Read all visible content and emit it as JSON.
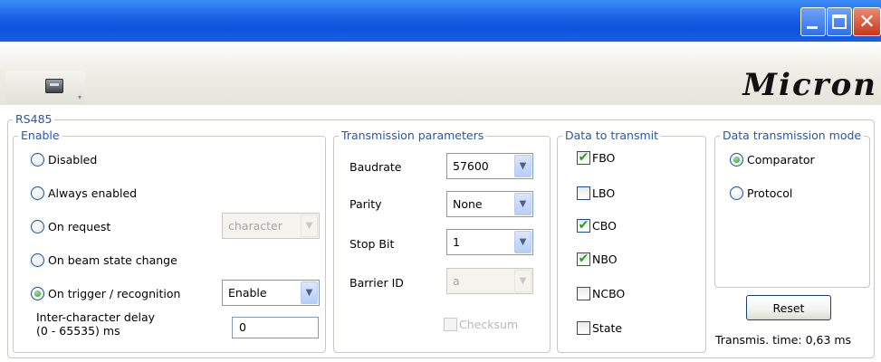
{
  "window": {
    "minimize_icon": "minimize-icon",
    "maximize_icon": "maximize-icon",
    "close_icon": "close-icon",
    "close_glyph": "✕"
  },
  "toolbar": {
    "device_icon": "device-icon",
    "dropdown_arrow": "▾",
    "logo_text": "Micron"
  },
  "rs485": {
    "title": "RS485",
    "enable": {
      "title": "Enable",
      "options": [
        {
          "label": "Disabled",
          "checked": false
        },
        {
          "label": "Always enabled",
          "checked": false
        },
        {
          "label": "On request",
          "checked": false
        },
        {
          "label": "On beam state change",
          "checked": false
        },
        {
          "label": "On trigger / recognition",
          "checked": true
        }
      ],
      "on_request_combo": {
        "value": "character",
        "disabled": true
      },
      "trigger_combo": {
        "value": "Enable",
        "disabled": false
      },
      "delay_label_line1": "Inter-character delay",
      "delay_label_line2": "(0 - 65535) ms",
      "delay_value": "0"
    },
    "transmission": {
      "title": "Transmission parameters",
      "baudrate_label": "Baudrate",
      "baudrate_value": "57600",
      "parity_label": "Parity",
      "parity_value": "None",
      "stopbit_label": "Stop Bit",
      "stopbit_value": "1",
      "barrier_label": "Barrier ID",
      "barrier_value": "a",
      "checksum_label": "Checksum",
      "checksum_checked": false,
      "checksum_disabled": true
    },
    "data_to_transmit": {
      "title": "Data to transmit",
      "items": [
        {
          "label": "FBO",
          "checked": true
        },
        {
          "label": "LBO",
          "checked": false
        },
        {
          "label": "CBO",
          "checked": true
        },
        {
          "label": "NBO",
          "checked": true
        },
        {
          "label": "NCBO",
          "checked": false
        },
        {
          "label": "State",
          "checked": false
        }
      ]
    },
    "mode": {
      "title": "Data transmission mode",
      "options": [
        {
          "label": "Comparator",
          "checked": true
        },
        {
          "label": "Protocol",
          "checked": false
        }
      ],
      "reset_label": "Reset",
      "transmis_time": "Transmis. time: 0,63 ms"
    }
  },
  "colors": {
    "titlebar": "#1b63e6",
    "legend_text": "#2456b4",
    "check_mark": "#21a121",
    "radio_dot": "#2f9d2a"
  }
}
